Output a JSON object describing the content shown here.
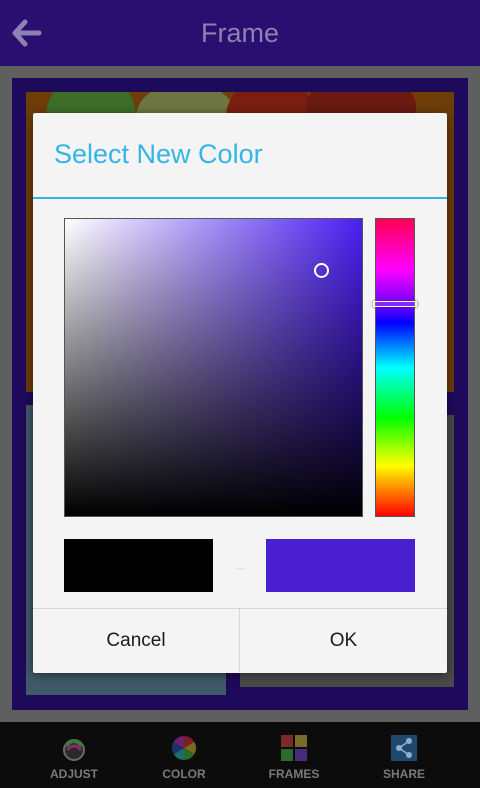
{
  "app_bar": {
    "title": "Frame",
    "back_icon": "arrow-left-icon"
  },
  "dialog": {
    "title": "Select New Color",
    "old_color": "#000000",
    "new_color": "#4a1fd1",
    "hue_color": "#4a1ff2",
    "cancel_label": "Cancel",
    "ok_label": "OK",
    "accent_color": "#33b5e5"
  },
  "toolbar": {
    "items": [
      {
        "label": "ADJUST",
        "icon": "adjust-icon"
      },
      {
        "label": "COLOR",
        "icon": "color-wheel-icon"
      },
      {
        "label": "FRAMES",
        "icon": "frames-icon"
      },
      {
        "label": "SHARE",
        "icon": "share-icon"
      }
    ]
  }
}
